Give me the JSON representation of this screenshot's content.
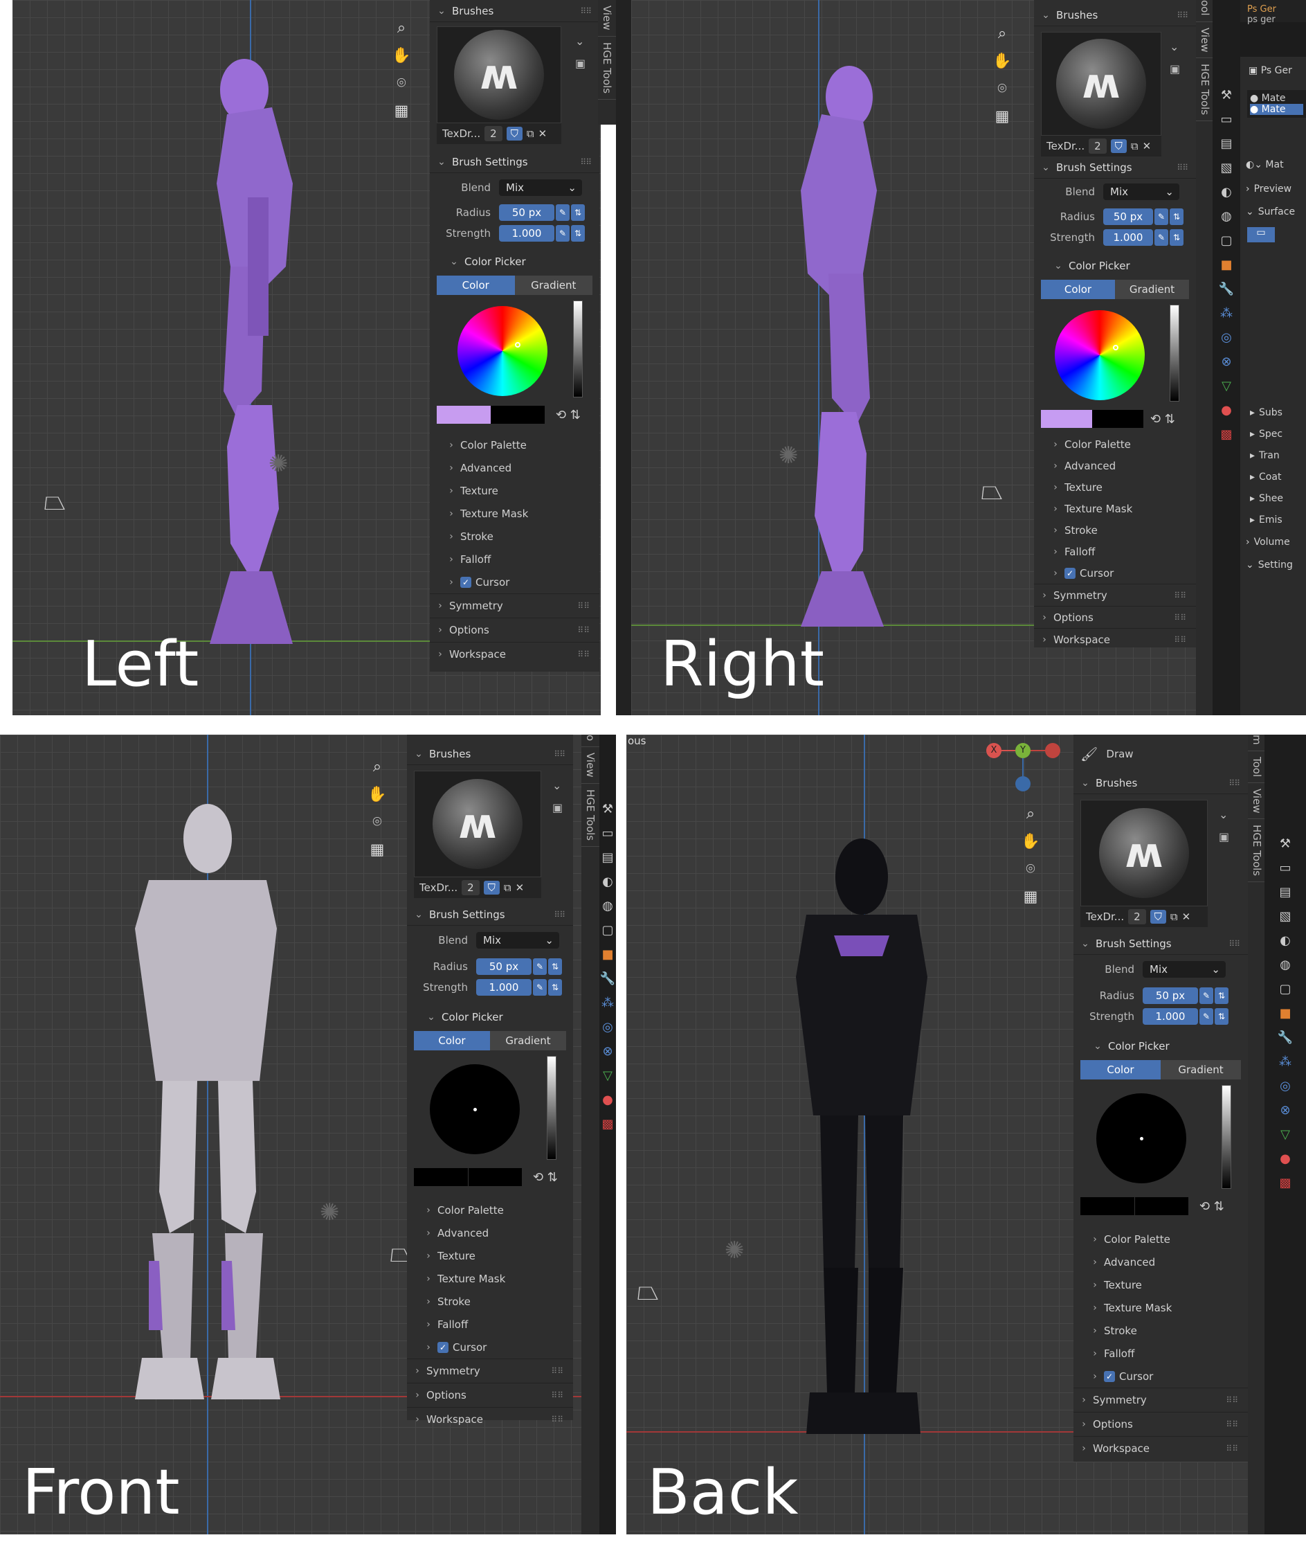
{
  "views": {
    "left": "Left",
    "right": "Right",
    "front": "Front",
    "back": "Back"
  },
  "side_tabs": {
    "tool_partial": "ool",
    "tool": "Tool",
    "view": "View",
    "hge": "HGE Tools",
    "m": "m",
    "o": "o"
  },
  "panel": {
    "brushes": "Brushes",
    "brush_name": "TexDr...",
    "brush_users": "2",
    "brush_settings": "Brush Settings",
    "blend_label": "Blend",
    "blend_value": "Mix",
    "radius_label": "Radius",
    "radius_value": "50 px",
    "strength_label": "Strength",
    "strength_value": "1.000",
    "color_picker": "Color Picker",
    "tab_color": "Color",
    "tab_gradient": "Gradient",
    "items": [
      "Color Palette",
      "Advanced",
      "Texture",
      "Texture Mask",
      "Stroke",
      "Falloff",
      "Cursor"
    ],
    "symmetry": "Symmetry",
    "options": "Options",
    "workspace": "Workspace",
    "draw": "Draw"
  },
  "properties": {
    "ps_gen": "Ps Ger",
    "ps_gen_small": "ps ger",
    "mat1": "Mate",
    "mat2": "Mate",
    "mat_field": "Mat",
    "preview": "Preview",
    "surface": "Surface",
    "subs": "Subs",
    "spec": "Spec",
    "tran": "Tran",
    "coat": "Coat",
    "shee": "Shee",
    "emis": "Emis",
    "volume": "Volume",
    "settings": "Setting"
  },
  "header_partial": "ous",
  "gizmo": {
    "x": "X",
    "y": "Y"
  },
  "colors": {
    "accent": "#4772b3",
    "left_swatch": "#c79cf0",
    "right_swatch": "#c69cf2",
    "model_purple": "#9b6ed8",
    "model_gray": "#c8c4cc",
    "model_black": "#101014"
  }
}
